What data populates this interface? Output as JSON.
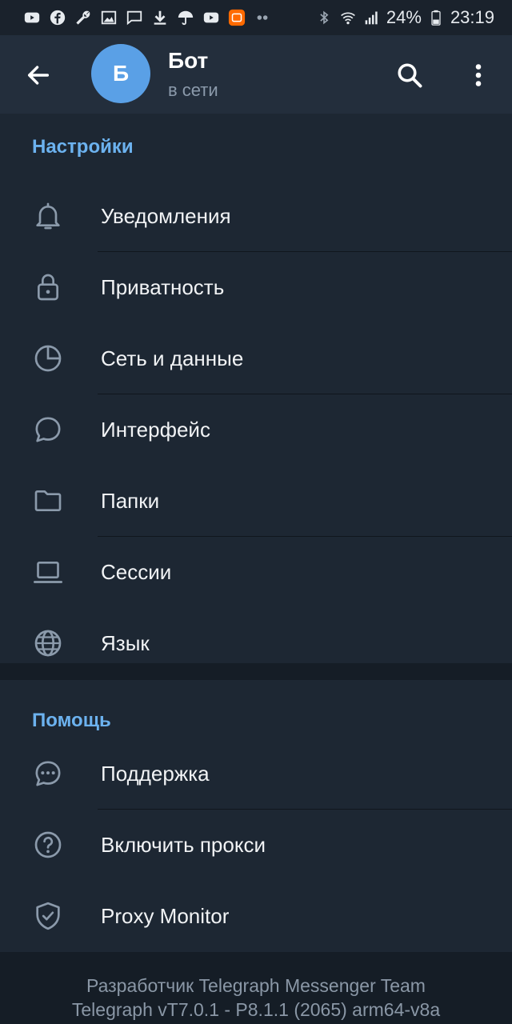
{
  "statusbar": {
    "battery_percent": "24%",
    "time": "23:19",
    "left_icons": [
      "youtube-icon",
      "facebook-icon",
      "wrench-icon",
      "image-icon",
      "chat-icon",
      "download-icon",
      "umbrella-icon",
      "youtube-icon",
      "mi-app-icon",
      "dots-icon"
    ],
    "right_icons": [
      "bluetooth-icon",
      "wifi-icon",
      "signal-icon",
      "battery-icon"
    ]
  },
  "header": {
    "avatar_letter": "Б",
    "title": "Бот",
    "status": "в сети",
    "avatar_color": "#5aa0e6"
  },
  "settings": {
    "title": "Настройки",
    "items": [
      {
        "label": "Уведомления",
        "icon": "bell-icon"
      },
      {
        "label": "Приватность",
        "icon": "lock-icon"
      },
      {
        "label": "Сеть и данные",
        "icon": "pie-chart-icon"
      },
      {
        "label": "Интерфейс",
        "icon": "speech-bubble-icon"
      },
      {
        "label": "Папки",
        "icon": "folder-icon"
      },
      {
        "label": "Сессии",
        "icon": "laptop-icon"
      },
      {
        "label": "Язык",
        "icon": "globe-icon"
      }
    ]
  },
  "help": {
    "title": "Помощь",
    "items": [
      {
        "label": "Поддержка",
        "icon": "chat-dots-icon"
      },
      {
        "label": "Включить прокси",
        "icon": "question-circle-icon"
      },
      {
        "label": "Proxy Monitor",
        "icon": "shield-check-icon"
      }
    ]
  },
  "footer": {
    "line1": "Разработчик Telegraph Messenger Team",
    "line2": "Telegraph vT7.0.1 - P8.1.1 (2065) arm64-v8a"
  },
  "colors": {
    "background": "#1d2733",
    "header": "#232e3c",
    "accent": "#6cb2ef",
    "icon_gray": "#8b9aab"
  }
}
